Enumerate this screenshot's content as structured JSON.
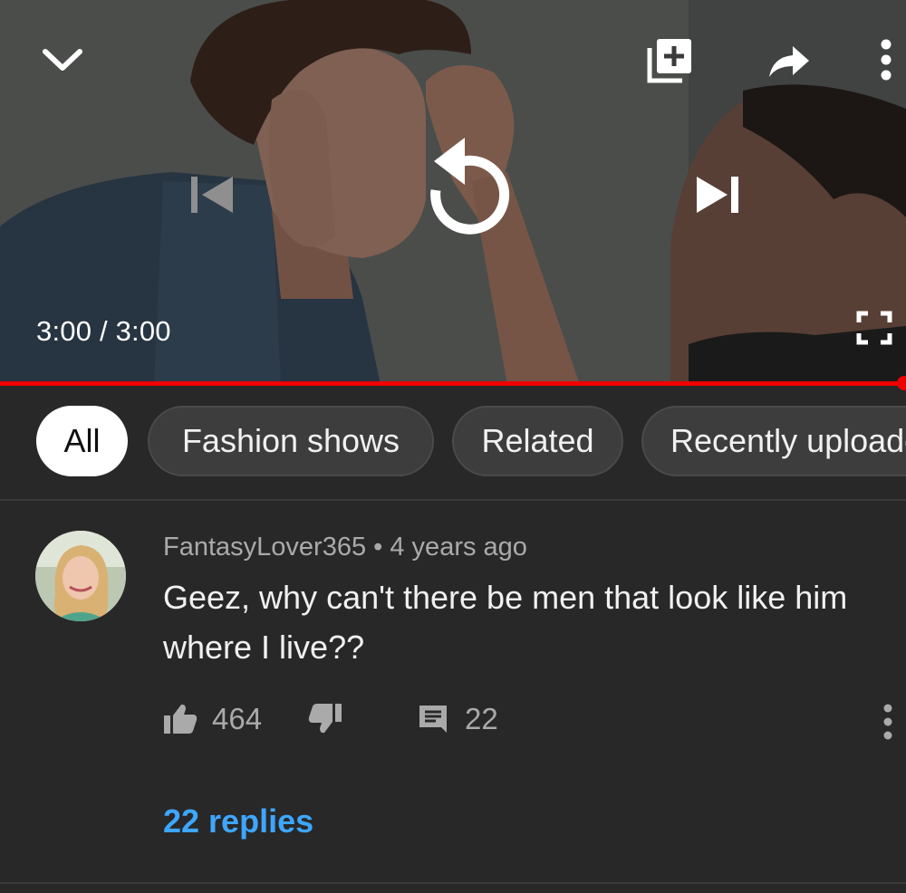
{
  "player": {
    "time_current": "3:00",
    "time_separator": " / ",
    "time_total": "3:00",
    "progress_fraction": 1.0,
    "accent_color": "#ee0000",
    "icons": {
      "collapse": "chevron-down-icon",
      "add_to_playlist": "add-to-queue-icon",
      "share": "share-arrow-icon",
      "more": "more-vert-icon",
      "previous": "skip-previous-icon",
      "replay": "replay-icon",
      "next": "skip-next-icon",
      "fullscreen": "fullscreen-icon"
    }
  },
  "chips": [
    {
      "label": "All",
      "active": true
    },
    {
      "label": "Fashion shows",
      "active": false
    },
    {
      "label": "Related",
      "active": false
    },
    {
      "label": "Recently uploaded",
      "active": false
    }
  ],
  "comment": {
    "author": "FantasyLover365",
    "separator": " • ",
    "age": "4 years ago",
    "text": "Geez, why can't there be men that look like him where I live??",
    "likes": "464",
    "reply_count": "22",
    "replies_link": "22 replies",
    "link_color": "#3ea6ff"
  }
}
